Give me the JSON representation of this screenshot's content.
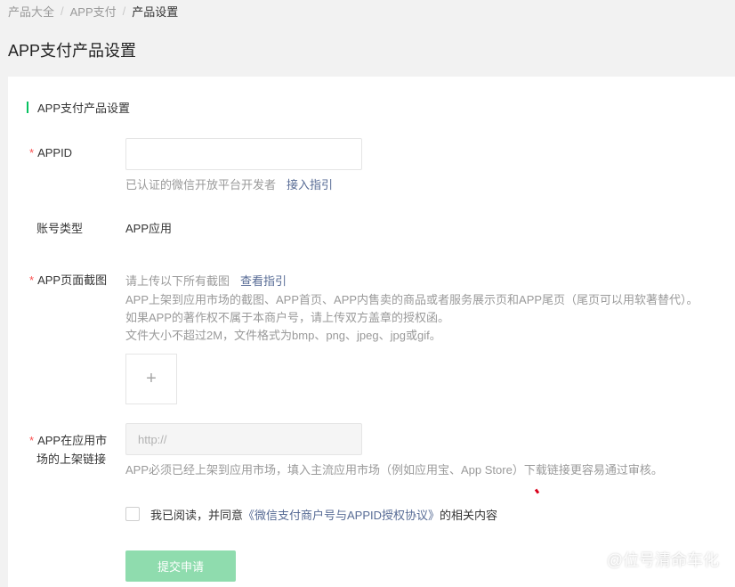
{
  "breadcrumb": {
    "items": [
      "产品大全",
      "APP支付",
      "产品设置"
    ],
    "separator": "/"
  },
  "page": {
    "title": "APP支付产品设置"
  },
  "section": {
    "title": "APP支付产品设置",
    "accent_color": "#07c160"
  },
  "appid": {
    "label": "APPID",
    "required_mark": "*",
    "value": "",
    "hint": "已认证的微信开放平台开发者",
    "guide_link": "接入指引"
  },
  "account_type": {
    "label": "账号类型",
    "value": "APP应用"
  },
  "screenshots": {
    "label": "APP页面截图",
    "required_mark": "*",
    "hint_intro": "请上传以下所有截图",
    "guide_link": "查看指引",
    "hint_line1": "APP上架到应用市场的截图、APP首页、APP内售卖的商品或者服务展示页和APP尾页（尾页可以用软著替代）。",
    "hint_line2": "如果APP的著作权不属于本商户号，请上传双方盖章的授权函。",
    "hint_line3": "文件大小不超过2M，文件格式为bmp、png、jpeg、jpg或gif。",
    "upload_symbol": "+"
  },
  "market_link": {
    "label_line1": "APP在应用市",
    "label_line2": "场的上架链接",
    "required_mark": "*",
    "placeholder": "http://",
    "hint": "APP必须已经上架到应用市场，填入主流应用市场（例如应用宝、App Store）下载链接更容易通过审核。"
  },
  "agreement": {
    "checked": false,
    "prefix": "我已阅读，并同意",
    "link": "《微信支付商户号与APPID授权协议》",
    "suffix": "的相关内容"
  },
  "submit": {
    "label": "提交申请",
    "color": "#8fdcae"
  },
  "watermark": {
    "text": "@位号清命车化",
    "icon": "watermark-logo-icon"
  }
}
